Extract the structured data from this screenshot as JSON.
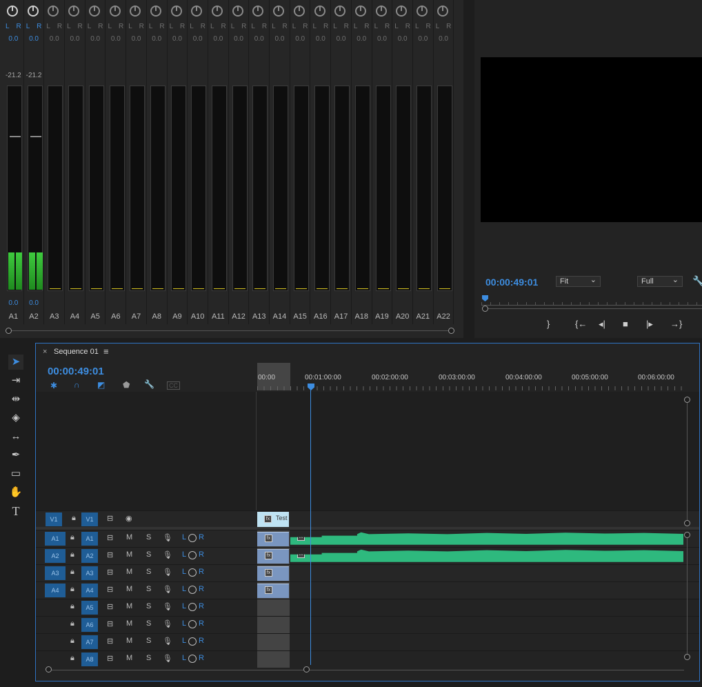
{
  "mixer": {
    "channels": [
      {
        "name": "A1",
        "L": "L",
        "R": "R",
        "pan": "0.0",
        "peak": "-21.2",
        "vol": "0.0",
        "active": true
      },
      {
        "name": "A2",
        "L": "L",
        "R": "R",
        "pan": "0.0",
        "peak": "-21.2",
        "vol": "0.0",
        "active": true
      },
      {
        "name": "A3",
        "L": "L",
        "R": "R",
        "pan": "0.0",
        "peak": "",
        "vol": "",
        "active": false
      },
      {
        "name": "A4",
        "L": "L",
        "R": "R",
        "pan": "0.0",
        "peak": "",
        "vol": "",
        "active": false
      },
      {
        "name": "A5",
        "L": "L",
        "R": "R",
        "pan": "0.0",
        "peak": "",
        "vol": "",
        "active": false
      },
      {
        "name": "A6",
        "L": "L",
        "R": "R",
        "pan": "0.0",
        "peak": "",
        "vol": "",
        "active": false
      },
      {
        "name": "A7",
        "L": "L",
        "R": "R",
        "pan": "0.0",
        "peak": "",
        "vol": "",
        "active": false
      },
      {
        "name": "A8",
        "L": "L",
        "R": "R",
        "pan": "0.0",
        "peak": "",
        "vol": "",
        "active": false
      },
      {
        "name": "A9",
        "L": "L",
        "R": "R",
        "pan": "0.0",
        "peak": "",
        "vol": "",
        "active": false
      },
      {
        "name": "A10",
        "L": "L",
        "R": "R",
        "pan": "0.0",
        "peak": "",
        "vol": "",
        "active": false
      },
      {
        "name": "A11",
        "L": "L",
        "R": "R",
        "pan": "0.0",
        "peak": "",
        "vol": "",
        "active": false
      },
      {
        "name": "A12",
        "L": "L",
        "R": "R",
        "pan": "0.0",
        "peak": "",
        "vol": "",
        "active": false
      },
      {
        "name": "A13",
        "L": "L",
        "R": "R",
        "pan": "0.0",
        "peak": "",
        "vol": "",
        "active": false
      },
      {
        "name": "A14",
        "L": "L",
        "R": "R",
        "pan": "0.0",
        "peak": "",
        "vol": "",
        "active": false
      },
      {
        "name": "A15",
        "L": "L",
        "R": "R",
        "pan": "0.0",
        "peak": "",
        "vol": "",
        "active": false
      },
      {
        "name": "A16",
        "L": "L",
        "R": "R",
        "pan": "0.0",
        "peak": "",
        "vol": "",
        "active": false
      },
      {
        "name": "A17",
        "L": "L",
        "R": "R",
        "pan": "0.0",
        "peak": "",
        "vol": "",
        "active": false
      },
      {
        "name": "A18",
        "L": "L",
        "R": "R",
        "pan": "0.0",
        "peak": "",
        "vol": "",
        "active": false
      },
      {
        "name": "A19",
        "L": "L",
        "R": "R",
        "pan": "0.0",
        "peak": "",
        "vol": "",
        "active": false
      },
      {
        "name": "A20",
        "L": "L",
        "R": "R",
        "pan": "0.0",
        "peak": "",
        "vol": "",
        "active": false
      },
      {
        "name": "A21",
        "L": "L",
        "R": "R",
        "pan": "0.0",
        "peak": "",
        "vol": "",
        "active": false
      },
      {
        "name": "A22",
        "L": "L",
        "R": "R",
        "pan": "0.0",
        "peak": "",
        "vol": "",
        "active": false
      }
    ]
  },
  "monitor": {
    "timecode": "00:00:49:01",
    "zoom": "Fit",
    "resolution": "Full",
    "transport": {
      "mark_out": "}",
      "go_in": "{←",
      "step_back": "◂|",
      "stop": "■",
      "step_fwd": "|▸",
      "go_out": "→}"
    }
  },
  "timeline": {
    "tab_title": "Sequence 01",
    "close": "×",
    "menu": "≡",
    "timecode": "00:00:49:01",
    "ruler": [
      "00:00",
      "00:01:00:00",
      "00:02:00:00",
      "00:03:00:00",
      "00:04:00:00",
      "00:05:00:00",
      "00:06:00:00"
    ],
    "cc": "CC",
    "video_track": {
      "src": "V1",
      "tgt": "V1",
      "clip": "Test",
      "fx": "fx"
    },
    "audio_tracks": [
      {
        "src": "A1",
        "tgt": "A1",
        "m": "M",
        "s": "S",
        "l": "L",
        "r": "R",
        "src_on": true,
        "clip": true,
        "wave": true
      },
      {
        "src": "A2",
        "tgt": "A2",
        "m": "M",
        "s": "S",
        "l": "L",
        "r": "R",
        "src_on": true,
        "clip": true,
        "wave": true
      },
      {
        "src": "A3",
        "tgt": "A3",
        "m": "M",
        "s": "S",
        "l": "L",
        "r": "R",
        "src_on": true,
        "clip": true,
        "wave": false
      },
      {
        "src": "A4",
        "tgt": "A4",
        "m": "M",
        "s": "S",
        "l": "L",
        "r": "R",
        "src_on": true,
        "clip": true,
        "wave": false
      },
      {
        "src": "",
        "tgt": "A5",
        "m": "M",
        "s": "S",
        "l": "L",
        "r": "R",
        "src_on": false,
        "clip": false,
        "wave": false
      },
      {
        "src": "",
        "tgt": "A6",
        "m": "M",
        "s": "S",
        "l": "L",
        "r": "R",
        "src_on": false,
        "clip": false,
        "wave": false
      },
      {
        "src": "",
        "tgt": "A7",
        "m": "M",
        "s": "S",
        "l": "L",
        "r": "R",
        "src_on": false,
        "clip": false,
        "wave": false
      },
      {
        "src": "",
        "tgt": "A8",
        "m": "M",
        "s": "S",
        "l": "L",
        "r": "R",
        "src_on": false,
        "clip": false,
        "wave": false
      }
    ]
  },
  "tools": [
    "selection",
    "track-select",
    "ripple-edit",
    "razor",
    "slip",
    "pen",
    "rectangle",
    "hand",
    "type"
  ],
  "colors": {
    "accent": "#3d8de0",
    "meter": "#3ecb3e",
    "waveform": "#2eb97e",
    "track_target": "#1f5d96"
  }
}
